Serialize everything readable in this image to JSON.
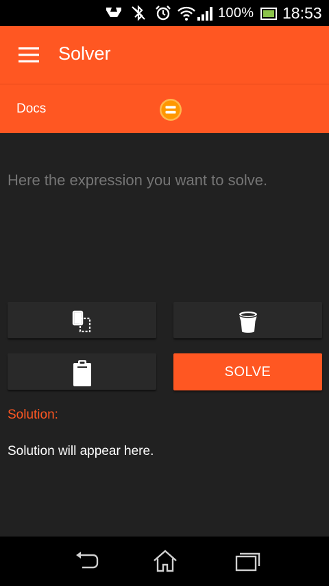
{
  "status_bar": {
    "icons": [
      "nfc-icon",
      "bluetooth-off-icon",
      "alarm-icon",
      "wifi-icon",
      "signal-icon",
      "battery-icon"
    ],
    "battery_percent": "100%",
    "time": "18:53"
  },
  "app_bar": {
    "menu_icon": "hamburger-menu-icon",
    "title": "Solver"
  },
  "tabs": [
    {
      "label": "Docs"
    },
    {
      "icon": "equals-icon"
    }
  ],
  "expression": {
    "placeholder": "Here the expression you want to solve.",
    "value": ""
  },
  "actions": {
    "copy_icon": "copy-icon",
    "delete_icon": "trash-icon",
    "paste_icon": "clipboard-icon",
    "solve_label": "SOLVE"
  },
  "solution": {
    "label": "Solution:",
    "text": "Solution will appear here."
  },
  "nav_bar": {
    "icons": [
      "back-icon",
      "home-icon",
      "recents-icon"
    ]
  },
  "colors": {
    "accent": "#ff5722",
    "background": "#212121",
    "button": "#292929",
    "placeholder": "#757575"
  }
}
